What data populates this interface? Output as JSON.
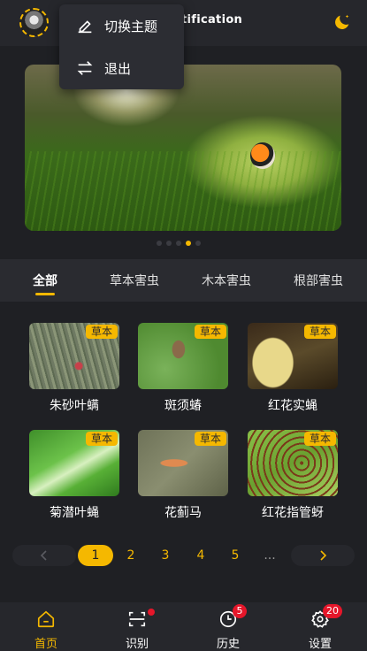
{
  "header": {
    "title": "tification",
    "avatar": "user-avatar",
    "theme_icon": "moon-icon"
  },
  "dropdown": {
    "items": [
      {
        "label": "切换主题",
        "icon": "pen-icon"
      },
      {
        "label": "退出",
        "icon": "swap-arrows-icon"
      }
    ]
  },
  "carousel": {
    "dots": 5,
    "active_index": 3
  },
  "tabs": [
    {
      "label": "全部",
      "active": true
    },
    {
      "label": "草本害虫",
      "active": false
    },
    {
      "label": "木本害虫",
      "active": false
    },
    {
      "label": "根部害虫",
      "active": false
    }
  ],
  "pests": [
    {
      "name": "朱砂叶螨",
      "badge": "草本"
    },
    {
      "name": "斑须蝽",
      "badge": "草本"
    },
    {
      "name": "红花实蝇",
      "badge": "草本"
    },
    {
      "name": "菊潜叶蝇",
      "badge": "草本"
    },
    {
      "name": "花蓟马",
      "badge": "草本"
    },
    {
      "name": "红花指管蚜",
      "badge": "草本"
    }
  ],
  "pagination": {
    "pages": [
      "1",
      "2",
      "3",
      "4",
      "5"
    ],
    "current": "1",
    "ellipsis": "..."
  },
  "nav": [
    {
      "label": "首页",
      "icon": "home-icon",
      "active": true,
      "badge": ""
    },
    {
      "label": "识别",
      "icon": "scan-icon",
      "active": false,
      "badge": "dot"
    },
    {
      "label": "历史",
      "icon": "history-clock-icon",
      "active": false,
      "badge": "5"
    },
    {
      "label": "设置",
      "icon": "gear-icon",
      "active": false,
      "badge": "20"
    }
  ],
  "colors": {
    "accent": "#f5b800",
    "background": "#1f2024",
    "badge_red": "#e5162a"
  }
}
